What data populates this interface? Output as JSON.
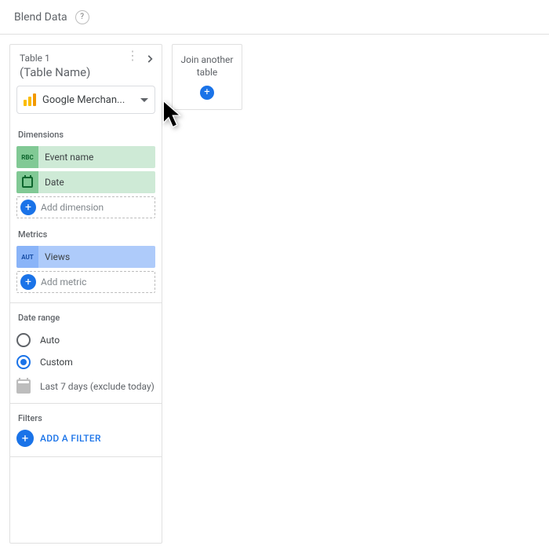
{
  "header": {
    "title": "Blend Data",
    "help": "?"
  },
  "table": {
    "number": "Table 1",
    "name": "(Table Name)",
    "datasource": "Google Merchan..."
  },
  "dimensions": {
    "label": "Dimensions",
    "items": [
      {
        "type": "RBC",
        "label": "Event name"
      },
      {
        "type": "DATE",
        "label": "Date"
      }
    ],
    "add": "Add dimension"
  },
  "metrics": {
    "label": "Metrics",
    "items": [
      {
        "type": "AUT",
        "label": "Views"
      }
    ],
    "add": "Add metric"
  },
  "dateRange": {
    "label": "Date range",
    "auto": "Auto",
    "custom": "Custom",
    "selected": "custom",
    "value": "Last 7 days (exclude today)"
  },
  "filters": {
    "label": "Filters",
    "add": "ADD A FILTER"
  },
  "join": {
    "label": "Join another table"
  }
}
